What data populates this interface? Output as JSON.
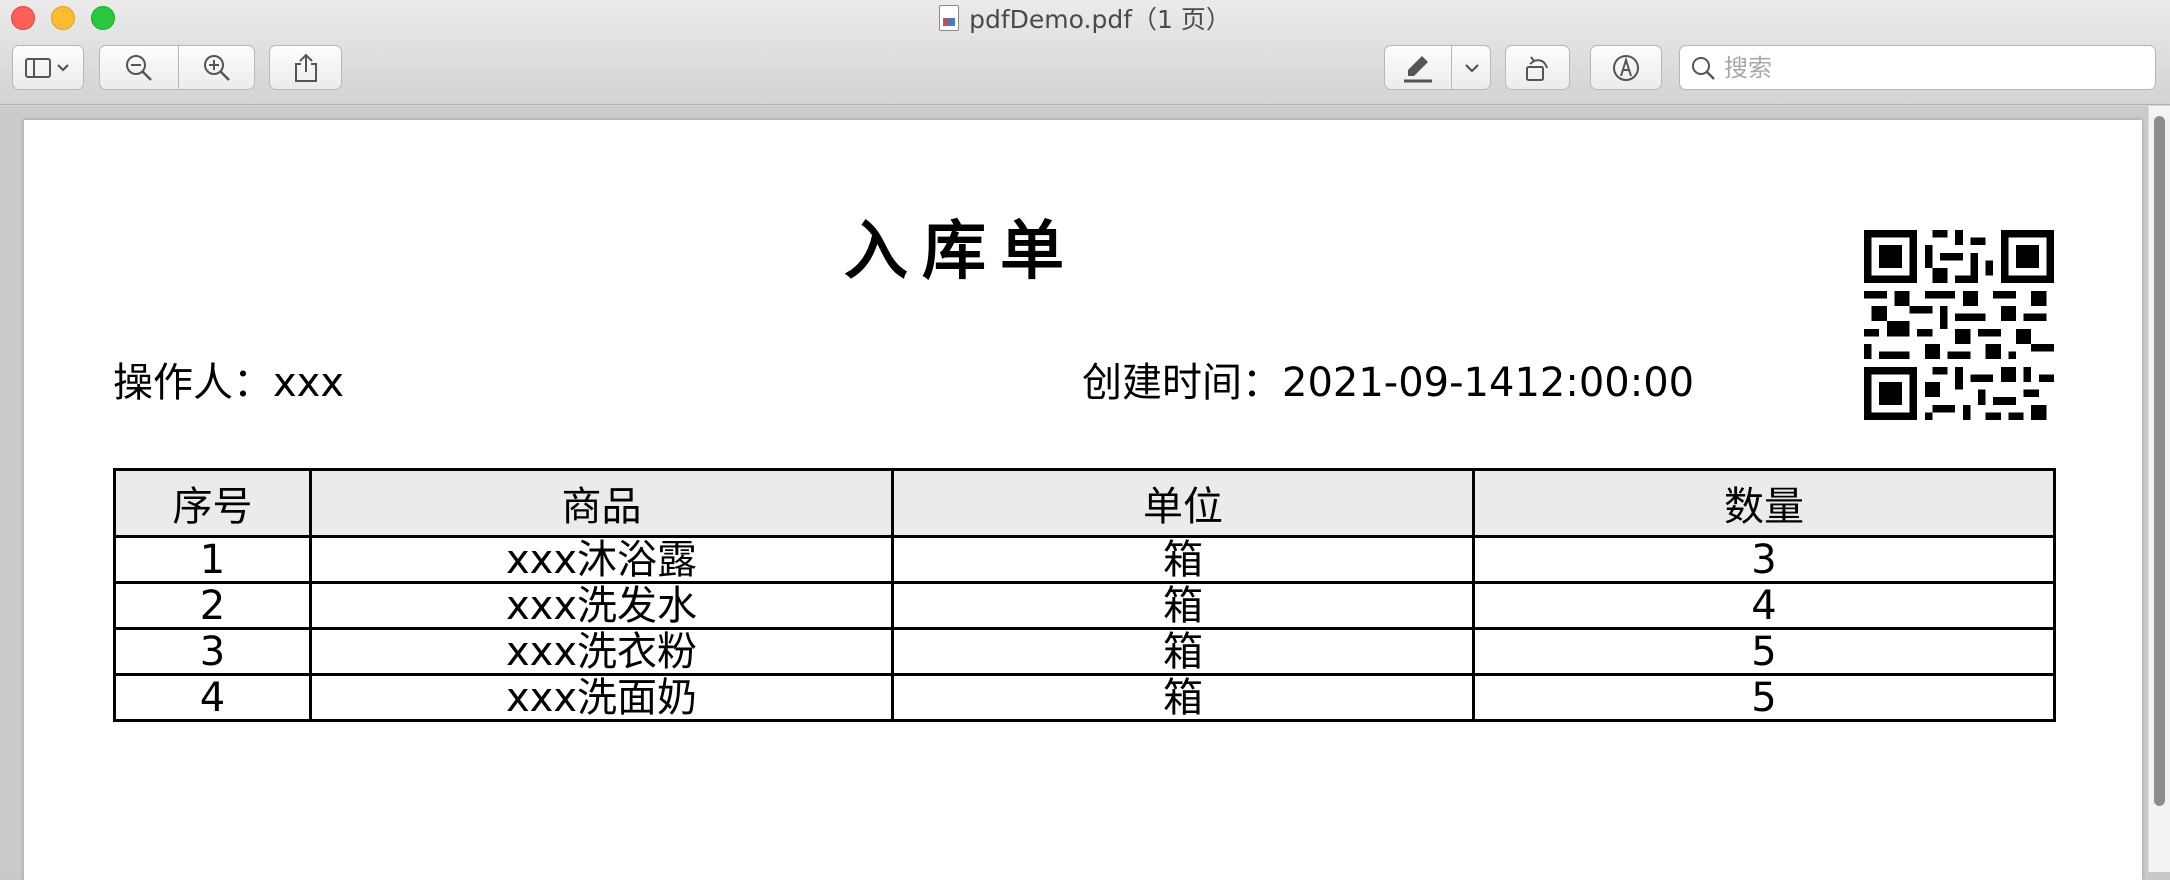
{
  "window": {
    "title": "pdfDemo.pdf（1 页）"
  },
  "toolbar": {
    "search_placeholder": "搜索",
    "icons": [
      "sidebar-icon",
      "zoom-out-icon",
      "zoom-in-icon",
      "share-icon",
      "highlight-icon",
      "rotate-icon",
      "markup-icon",
      "search-icon"
    ]
  },
  "document": {
    "title": "入库单",
    "operator": "操作人：xxx",
    "created": "创建时间：2021-09-1412:00:00",
    "table": {
      "headers": [
        "序号",
        "商品",
        "单位",
        "数量"
      ],
      "rows": [
        [
          "1",
          "xxx沐浴露",
          "箱",
          "3"
        ],
        [
          "2",
          "xxx洗发水",
          "箱",
          "4"
        ],
        [
          "3",
          "xxx洗衣粉",
          "箱",
          "5"
        ],
        [
          "4",
          "xxx洗面奶",
          "箱",
          "5"
        ]
      ]
    }
  },
  "colors": {
    "close": "#fe5f57",
    "minimize": "#febc2e",
    "maximize": "#28c840",
    "header_fill": "#ebebeb"
  }
}
